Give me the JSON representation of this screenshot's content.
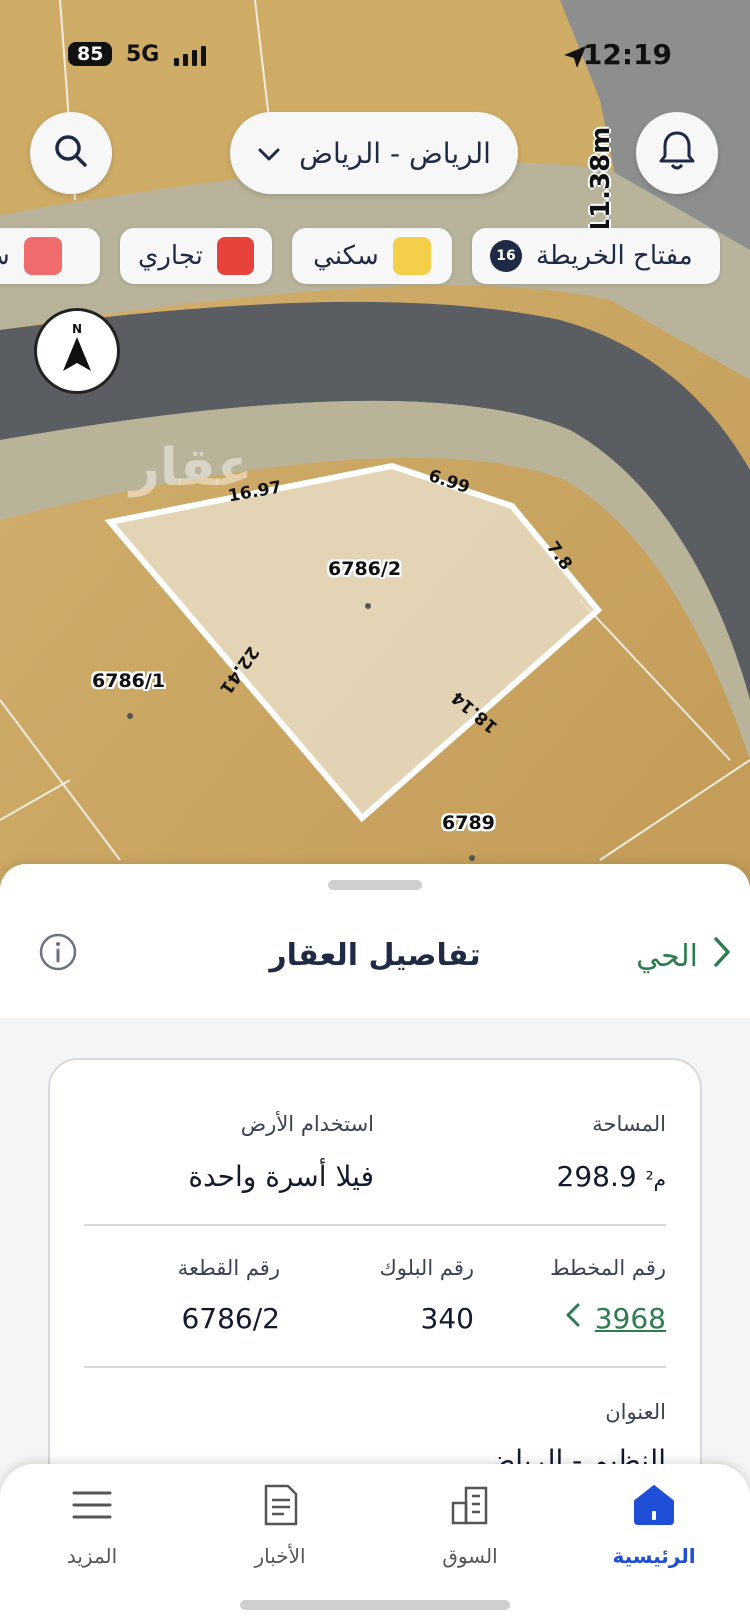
{
  "status_bar": {
    "battery": "85",
    "network": "5G",
    "time": "12:19"
  },
  "map": {
    "location": "الرياض - الرياض",
    "scale_label": "11.38m",
    "watermark": "عقار",
    "legend_chips": [
      {
        "label": "مفتاح الخريطة",
        "badge": "16"
      },
      {
        "label": "سكني",
        "color": "#f3cf4a"
      },
      {
        "label": "تجاري",
        "color": "#e8423c"
      },
      {
        "label": "ش",
        "color": "#f06b6b"
      }
    ],
    "compass_letter": "N",
    "plots": {
      "main": "6786/2",
      "left": "6786/1",
      "bottom": "6789"
    },
    "dimensions": {
      "top_left": "16.97",
      "top_right": "6.99",
      "right": "7.8",
      "left": "22.41",
      "bottom": "18.14"
    }
  },
  "sheet": {
    "title": "تفاصيل العقار",
    "back_label": "الحي",
    "fields": {
      "area_label": "المساحة",
      "area_value": "298.9",
      "area_unit": "م²",
      "land_use_label": "استخدام الأرض",
      "land_use_value": "فيلا أسرة واحدة",
      "plan_label": "رقم المخطط",
      "plan_value": "3968",
      "block_label": "رقم البلوك",
      "block_value": "340",
      "plot_label": "رقم القطعة",
      "plot_value": "6786/2",
      "address_label": "العنوان",
      "address_value": "النظيم - الرياض"
    }
  },
  "tabs": {
    "home": "الرئيسية",
    "market": "السوق",
    "news": "الأخبار",
    "more": "المزيد"
  },
  "colors": {
    "accent_green": "#2e7d4f",
    "accent_blue": "#1f4fd6",
    "navy": "#1f2a44"
  }
}
